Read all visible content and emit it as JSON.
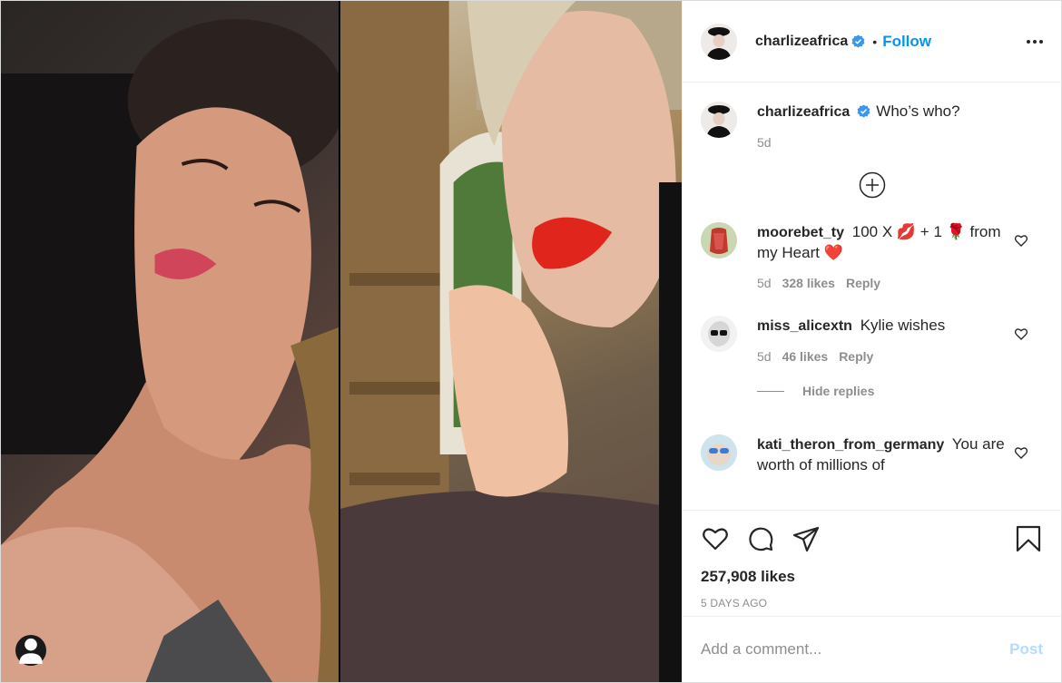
{
  "post": {
    "author": {
      "username": "charlizeafrica",
      "verified": true,
      "follow_label": "Follow",
      "separator": "•"
    },
    "caption": {
      "username": "charlizeafrica",
      "text": "Who’s who?",
      "time": "5d"
    },
    "comments": [
      {
        "username": "moorebet_ty",
        "text": "100 X 💋 + 1 🌹 from my Heart ❤️",
        "time": "5d",
        "likes": "328 likes",
        "reply_label": "Reply"
      },
      {
        "username": "miss_alicextn",
        "text": "Kylie wishes",
        "time": "5d",
        "likes": "46 likes",
        "reply_label": "Reply"
      },
      {
        "username": "kati_theron_from_germany",
        "text": "You are worth of millions of"
      }
    ],
    "hide_replies_label": "Hide replies",
    "like_count": "257,908 likes",
    "posted_ago": "5 DAYS AGO",
    "add_comment_placeholder": "Add a comment...",
    "post_label": "Post",
    "icons": {
      "more": "more-options-icon",
      "load_more": "plus-circle-icon",
      "like": "heart-icon",
      "comment": "comment-icon",
      "share": "share-icon",
      "save": "bookmark-icon",
      "tagged_users": "user-tag-icon"
    },
    "colors": {
      "accent": "#0095f6",
      "post_disabled": "#b3dbff",
      "secondary_text": "#8e8e8e",
      "primary_text": "#262626"
    }
  }
}
